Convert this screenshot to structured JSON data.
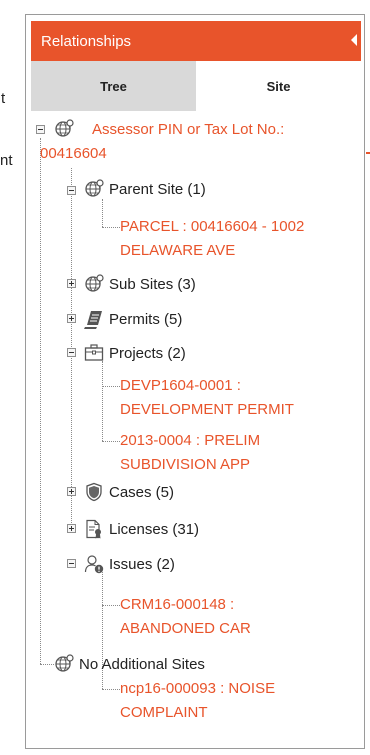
{
  "background": {
    "frag_1": "t",
    "frag_2": "nt"
  },
  "panel": {
    "title": "Relationships",
    "tabs": [
      {
        "label": "Tree",
        "active": false
      },
      {
        "label": "Site",
        "active": true
      }
    ]
  },
  "tree": {
    "root": {
      "line1": "Assessor PIN or Tax Lot No.:",
      "line2": "00416604"
    },
    "parent_site": {
      "label": "Parent Site (1)",
      "icon": "globe-icon"
    },
    "parent_item": {
      "line1": "PARCEL : 00416604 - 1002",
      "line2": "DELAWARE AVE"
    },
    "sub_sites": {
      "label": "Sub Sites (3)",
      "icon": "globe-icon"
    },
    "permits": {
      "label": "Permits (5)",
      "icon": "permit-icon"
    },
    "projects": {
      "label": "Projects (2)",
      "icon": "briefcase-icon"
    },
    "project_1": {
      "line1": "DEVP1604-0001 :",
      "line2": "DEVELOPMENT PERMIT"
    },
    "project_2": {
      "line1": "2013-0004 : PRELIM",
      "line2": "SUBDIVISION APP"
    },
    "cases": {
      "label": "Cases (5)",
      "icon": "shield-icon"
    },
    "licenses": {
      "label": "Licenses (31)",
      "icon": "license-icon"
    },
    "issues": {
      "label": "Issues (2)",
      "icon": "issue-icon"
    },
    "issue_1": {
      "line1": "CRM16-000148 :",
      "line2": "ABANDONED CAR"
    },
    "issue_2": {
      "line1": "ncp16-000093 : NOISE",
      "line2": "COMPLAINT"
    },
    "no_additional": {
      "label": "No Additional Sites",
      "icon": "globe-icon"
    }
  },
  "colors": {
    "accent": "#e8542b",
    "tab_inactive": "#d9d9d9",
    "border": "#9a9a9a"
  }
}
